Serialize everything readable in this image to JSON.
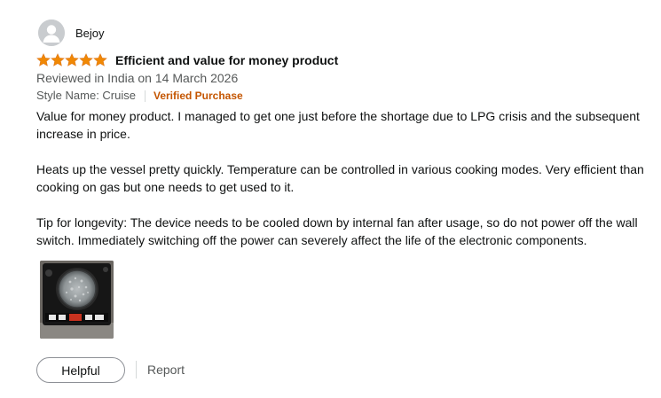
{
  "review": {
    "reviewer_name": "Bejoy",
    "avatar_icon": "user-avatar-icon",
    "rating": 5,
    "rating_max": 5,
    "star_color": "#f08804",
    "title": "Efficient and value for money product",
    "date_line": "Reviewed in India on 14 March 2026",
    "style_label": "Style Name: Cruise",
    "verified_label": "Verified Purchase",
    "verified_color": "#c45500",
    "body": [
      "Value for money product. I managed to get one just before the shortage due to LPG crisis and the subsequent increase in price.",
      "Heats up the vessel pretty quickly. Temperature can be controlled in various cooking modes. Very efficient than cooking on gas but one needs to get used to it.",
      "Tip for longevity: The device needs to be cooled down by internal fan after usage, so do not power off the wall switch. Immediately switching off the power can severely affect the life of the electronic components."
    ]
  },
  "actions": {
    "helpful_label": "Helpful",
    "report_label": "Report"
  }
}
